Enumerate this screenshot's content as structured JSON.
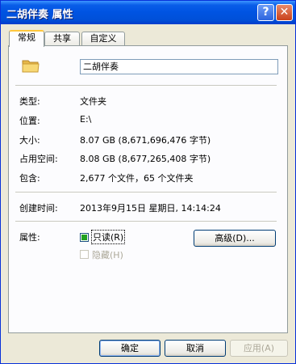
{
  "window": {
    "title": "二胡伴奏 属性",
    "help_glyph": "?",
    "close_glyph": "✕"
  },
  "tabs": [
    {
      "label": "常规",
      "active": true
    },
    {
      "label": "共享",
      "active": false
    },
    {
      "label": "自定义",
      "active": false
    }
  ],
  "general": {
    "name": "二胡伴奏",
    "rows": [
      {
        "label": "类型:",
        "value": "文件夹"
      },
      {
        "label": "位置:",
        "value": "E:\\"
      },
      {
        "label": "大小:",
        "value": "8.07 GB (8,671,696,476 字节)"
      },
      {
        "label": "占用空间:",
        "value": "8.08 GB (8,677,265,408 字节)"
      },
      {
        "label": "包含:",
        "value": "2,677 个文件，65 个文件夹"
      }
    ],
    "created_label": "创建时间:",
    "created_value": "2013年9月15日 星期日, 14:14:24",
    "attributes_label": "属性:",
    "readonly_label": "只读(R)",
    "hidden_label": "隐藏(H)",
    "advanced_label": "高级(D)..."
  },
  "buttons": {
    "ok": "确定",
    "cancel": "取消",
    "apply": "应用(A)"
  }
}
